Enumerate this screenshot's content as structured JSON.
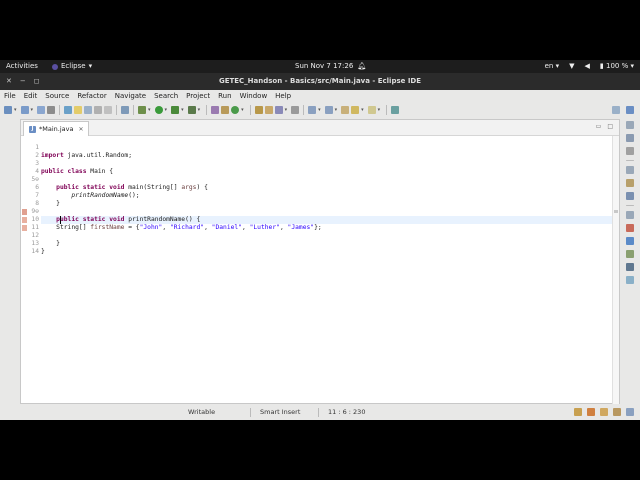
{
  "os_bar": {
    "activities": "Activities",
    "app_name": "Eclipse",
    "clock": "Sun Nov 7  17:26",
    "language": "en",
    "battery": "100 %"
  },
  "window": {
    "title": "GETEC_Handson - Basics/src/Main.java - Eclipse IDE"
  },
  "menu": [
    "File",
    "Edit",
    "Source",
    "Refactor",
    "Navigate",
    "Search",
    "Project",
    "Run",
    "Window",
    "Help"
  ],
  "editor": {
    "tab_label": "*Main.java",
    "lines": [
      {
        "n": "1",
        "code": "import java.util.Random;"
      },
      {
        "n": "2",
        "code": ""
      },
      {
        "n": "3",
        "code": "public class Main {"
      },
      {
        "n": "4",
        "code": ""
      },
      {
        "n": "5⊖",
        "code": "    public static void main(String[] args) {"
      },
      {
        "n": "6",
        "code": "        printRandomName();"
      },
      {
        "n": "7",
        "code": "    }"
      },
      {
        "n": "8",
        "code": ""
      },
      {
        "n": "9⊖",
        "code": "    public static void printRandomName() {"
      },
      {
        "n": "10",
        "code": "    String[] firstName = {\"John\", \"Richard\", \"Daniel\", \"Luther\", \"James\"};"
      },
      {
        "n": "11",
        "code": ""
      },
      {
        "n": "12",
        "code": "    }"
      },
      {
        "n": "13",
        "code": "}"
      },
      {
        "n": "14",
        "code": ""
      }
    ]
  },
  "status": {
    "mode": "Writable",
    "insert": "Smart Insert",
    "position": "11 : 6 : 230"
  }
}
